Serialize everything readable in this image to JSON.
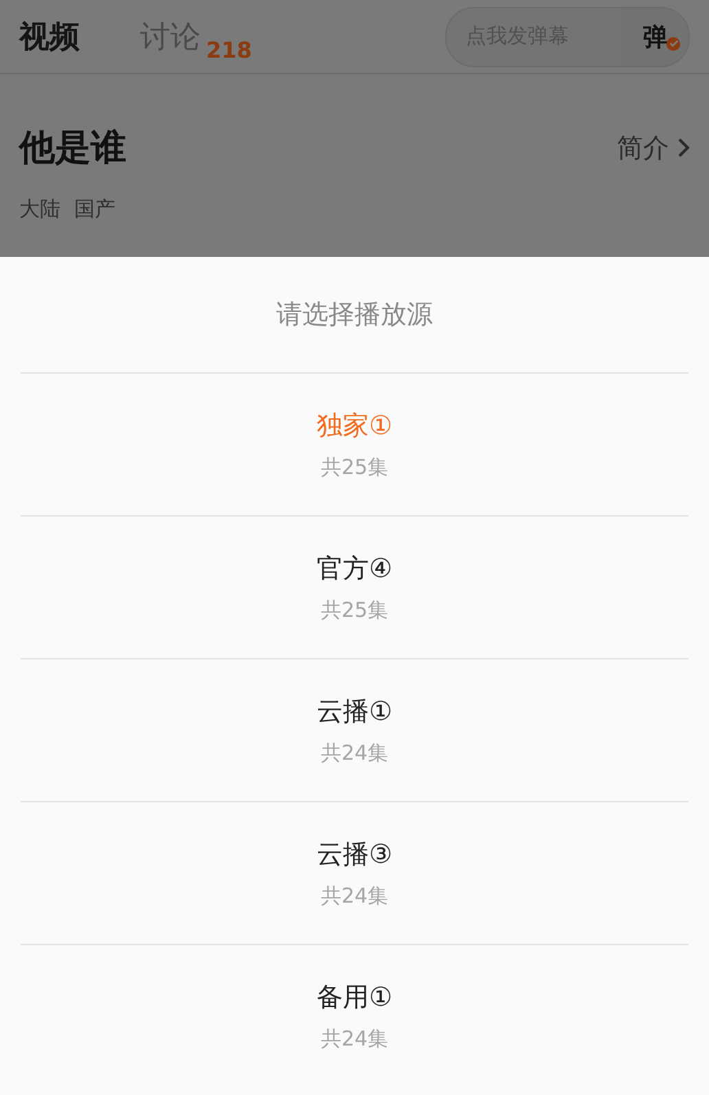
{
  "tabs": [
    {
      "label": "视频",
      "selected": true
    },
    {
      "label": "讨论",
      "selected": false,
      "count": "218"
    }
  ],
  "danmaku": {
    "placeholder": "点我发弹幕",
    "toggle": "弹",
    "on": true
  },
  "show": {
    "title": "他是谁",
    "intro_link": "简介",
    "tags": [
      "大陆",
      "国产"
    ]
  },
  "sheet": {
    "title": "请选择播放源",
    "sources": [
      {
        "name": "独家①",
        "episodes": "共25集",
        "selected": true
      },
      {
        "name": "官方④",
        "episodes": "共25集",
        "selected": false
      },
      {
        "name": "云播①",
        "episodes": "共24集",
        "selected": false
      },
      {
        "name": "云播③",
        "episodes": "共24集",
        "selected": false
      },
      {
        "name": "备用①",
        "episodes": "共24集",
        "selected": false
      }
    ]
  }
}
